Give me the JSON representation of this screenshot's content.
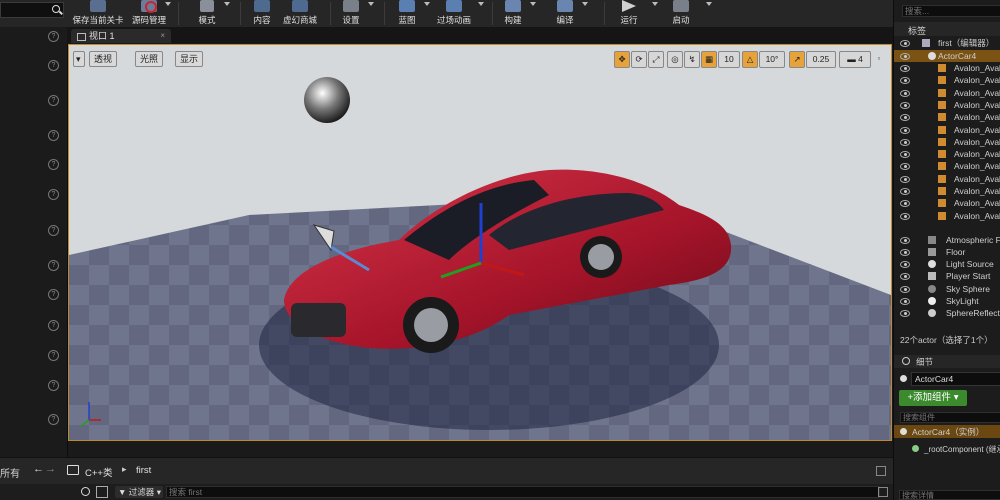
{
  "toolbar": {
    "buttons": [
      {
        "label": "保存当前关卡",
        "icon": "save-icon"
      },
      {
        "label": "源码管理",
        "icon": "source-control-icon"
      },
      {
        "label": "模式",
        "icon": "modes-icon"
      },
      {
        "label": "内容",
        "icon": "content-icon"
      },
      {
        "label": "虚幻商城",
        "icon": "marketplace-icon"
      },
      {
        "label": "设置",
        "icon": "settings-icon"
      },
      {
        "label": "蓝图",
        "icon": "blueprint-icon"
      },
      {
        "label": "过场动画",
        "icon": "cinematics-icon"
      },
      {
        "label": "构建",
        "icon": "build-icon"
      },
      {
        "label": "编译",
        "icon": "compile-icon"
      },
      {
        "label": "运行",
        "icon": "play-icon"
      },
      {
        "label": "启动",
        "icon": "launch-icon"
      }
    ]
  },
  "viewport": {
    "tab_label": "视口 1",
    "perspective_label": "透视",
    "lit_label": "光照",
    "show_label": "显示",
    "grid_snap": "10",
    "rotation_snap": "10°",
    "scale_snap": "0.25",
    "camera_speed": "4"
  },
  "outliner": {
    "search_placeholder": "搜索...",
    "column_label": "标签",
    "root_label": "first（编辑器）",
    "selected_actor": "ActorCar4",
    "children": [
      "Avalon_Avalon",
      "Avalon_Avalon",
      "Avalon_Avalon",
      "Avalon_Avalon",
      "Avalon_Avalon",
      "Avalon_Avalon",
      "Avalon_Avalon",
      "Avalon_Avalon",
      "Avalon_Avalon",
      "Avalon_Avalon",
      "Avalon_Avalon",
      "Avalon_Avalon",
      "Avalon_Avalon"
    ],
    "actors": [
      {
        "label": "Atmospheric Fog",
        "icon": "fog-icon"
      },
      {
        "label": "Floor",
        "icon": "mesh-icon"
      },
      {
        "label": "Light Source",
        "icon": "light-icon"
      },
      {
        "label": "Player Start",
        "icon": "player-start-icon"
      },
      {
        "label": "Sky Sphere",
        "icon": "sphere-icon"
      },
      {
        "label": "SkyLight",
        "icon": "skylight-icon"
      },
      {
        "label": "SphereReflectionCapture",
        "icon": "reflection-icon"
      }
    ],
    "status": "22个actor（选择了1个）"
  },
  "details": {
    "tab_label": "细节",
    "actor_name": "ActorCar4",
    "add_component_label": "+添加组件",
    "search_placeholder": "搜索组件",
    "instance_label": "ActorCar4（实例）",
    "root_component": "_rootComponent (继承)",
    "search_details_placeholder": "搜索详情"
  },
  "content_browser": {
    "left_label": "所有",
    "path": [
      "C++类",
      "first"
    ],
    "filter_label": "过滤器",
    "search_placeholder": "搜索 first"
  },
  "colors": {
    "selection": "#e8a23a",
    "car": "#b0182c",
    "add_button": "#3c8a2e"
  }
}
